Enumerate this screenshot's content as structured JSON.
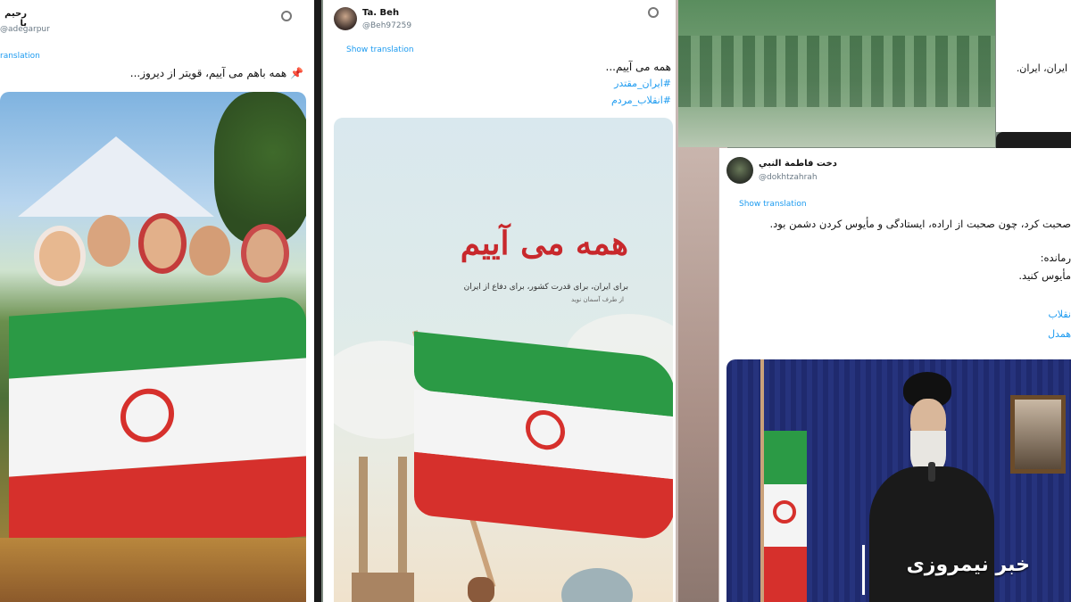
{
  "card1": {
    "name": "رحیم با",
    "handle": "@adegarpur",
    "translation": "ranslation",
    "text": "همه باهم می آییم، قویتر از دیروز...",
    "pin": "📌"
  },
  "card2": {
    "name": "Ta. Beh",
    "handle": "@Beh97259",
    "translation": "Show translation",
    "line1": "همه می آییم...",
    "tag1": "#ایران_مقتدر",
    "tag2": "#انقلاب_مردم",
    "poster_title": "همه می آییم",
    "poster_sub": "برای ایران، برای قدرت کشور، برای دفاع از ایران",
    "poster_note": "از طرف آسمان نوید"
  },
  "card3": {
    "line": "ایران، ایران."
  },
  "card4": {
    "name": "دخت فاطمة النبي",
    "handle": "@dokhtzahrah",
    "translation": "Show translation",
    "line1": "صحبت کرد، چون صحبت از اراده، ایستادگی و مأیوس کردن دشمن بود.",
    "line2": "رمانده:",
    "line3": "مأیوس کنید.",
    "tag1": "نقلاب",
    "tag2": "همدل"
  },
  "overlay": {
    "news": "خبر نیمروزی"
  },
  "colors": {
    "green": "#2b9a45",
    "red": "#d6302c",
    "link": "#1d9bf0"
  }
}
